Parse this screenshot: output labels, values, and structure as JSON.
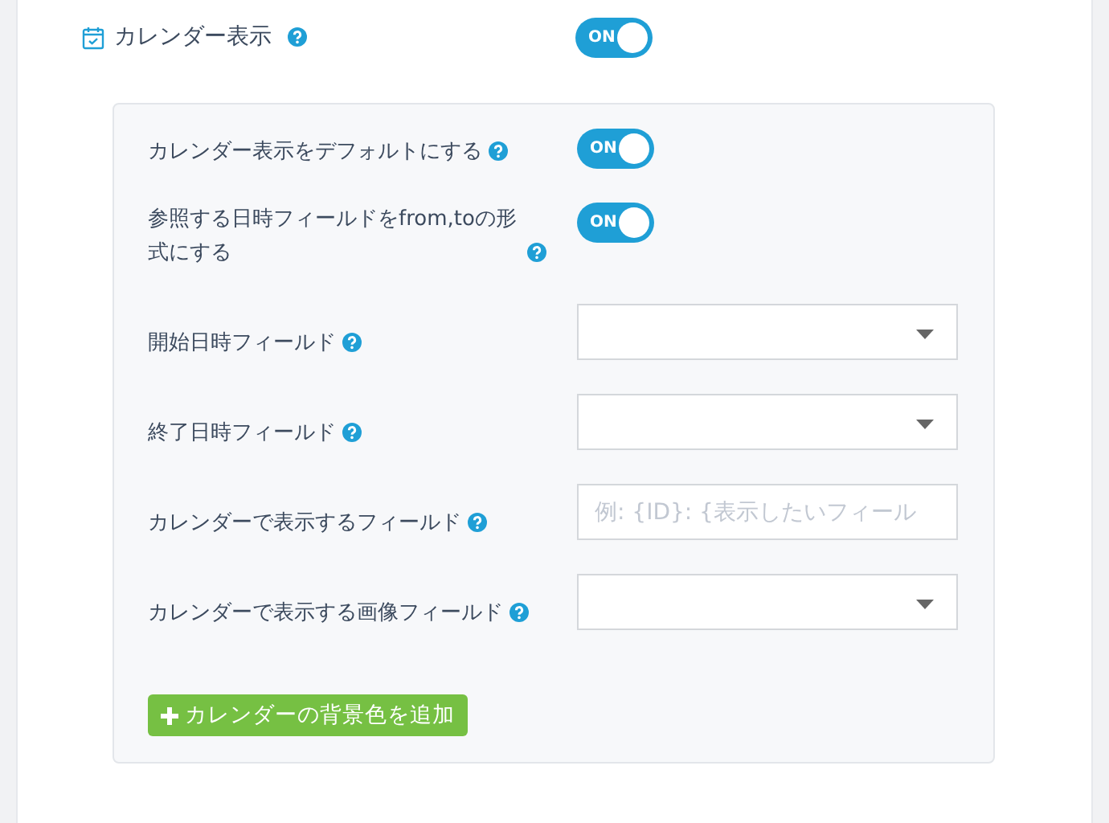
{
  "main_setting": {
    "label": "カレンダー表示",
    "on": true,
    "toggle_text": "ON"
  },
  "settings": [
    {
      "kind": "toggle",
      "label": "カレンダー表示をデフォルトにする",
      "on": true,
      "toggle_text": "ON"
    },
    {
      "kind": "toggle",
      "label": "参照する日時フィールドをfrom,toの形式にする",
      "on": true,
      "toggle_text": "ON"
    },
    {
      "kind": "select",
      "label": "開始日時フィールド"
    },
    {
      "kind": "select",
      "label": "終了日時フィールド"
    },
    {
      "kind": "text",
      "label": "カレンダーで表示するフィールド",
      "placeholder": "例: {ID}: {表示したいフィール"
    },
    {
      "kind": "select",
      "label": "カレンダーで表示する画像フィールド"
    }
  ],
  "add_button": {
    "label": "カレンダーの背景色を追加"
  }
}
